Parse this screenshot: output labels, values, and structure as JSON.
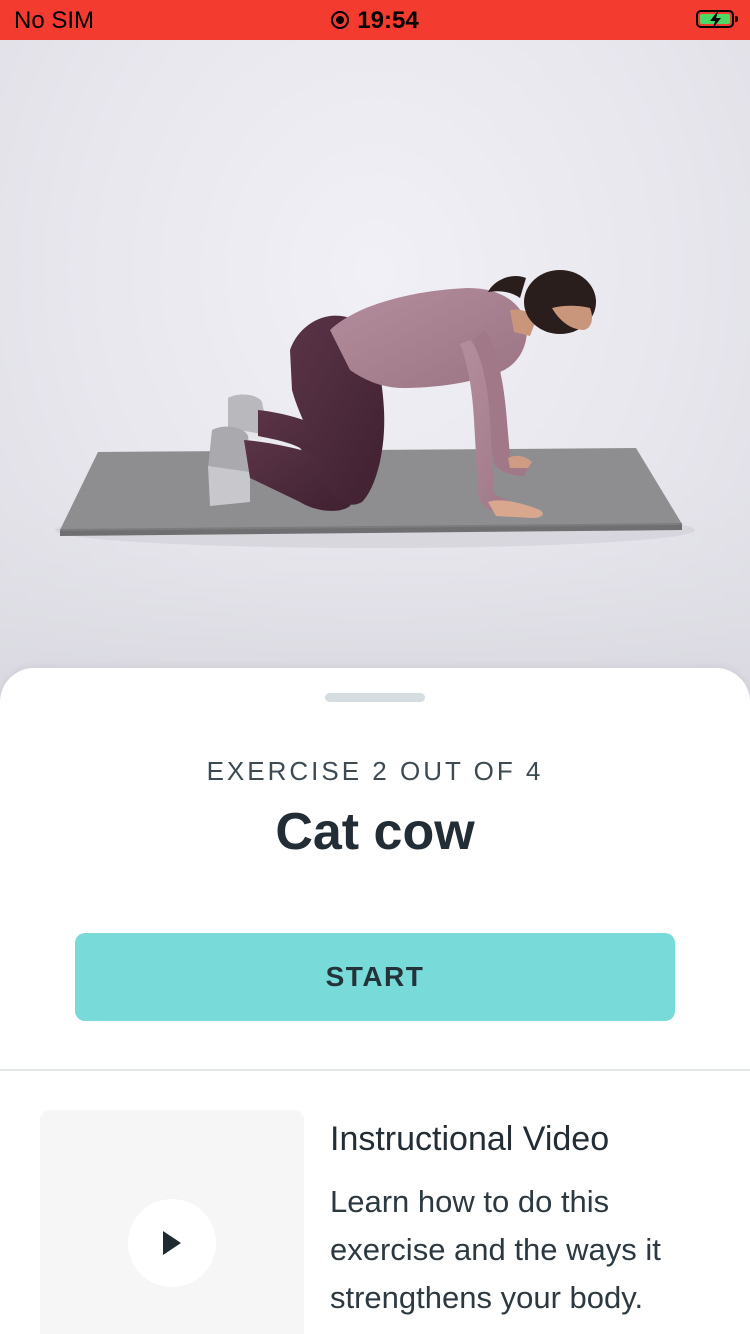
{
  "status_bar": {
    "carrier": "No SIM",
    "time": "19:54",
    "background_color": "#f33b30",
    "battery_level": 1.0,
    "battery_charging": true,
    "icons": [
      "screen-recording-icon",
      "battery-charging-icon"
    ]
  },
  "hero": {
    "image_subject": "exercise-demo-photo"
  },
  "sheet": {
    "counter": "EXERCISE 2 OUT OF 4",
    "title": "Cat cow",
    "start_label": "START",
    "accent_color": "#79dbd9"
  },
  "video": {
    "title": "Instructional Video",
    "description": "Learn how to do this exercise and the ways it strengthens your body.",
    "play_icon": "play-icon"
  }
}
